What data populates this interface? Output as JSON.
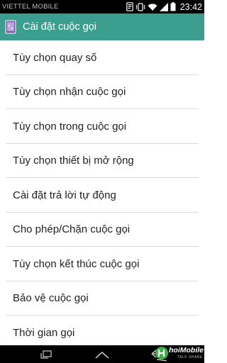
{
  "status_bar": {
    "carrier": "VIETTEL MOBILE",
    "time": "23:42",
    "icons": [
      "notification-icon",
      "vibrate-icon",
      "wifi-icon",
      "signal-icon",
      "battery-icon"
    ]
  },
  "action_bar": {
    "title": "Cài đặt cuộc gọi",
    "background_color": "#3b9e8e"
  },
  "settings_list": {
    "items": [
      {
        "label": "Tùy chọn quay số"
      },
      {
        "label": "Tùy chọn nhận cuộc gọi"
      },
      {
        "label": "Tùy chọn trong cuộc gọi"
      },
      {
        "label": "Tùy chọn thiết bị mở rộng"
      },
      {
        "label": "Cài đặt trả lời tự động"
      },
      {
        "label": "Cho phép/Chặn cuộc gọi"
      },
      {
        "label": "Tùy chọn kết thúc cuộc gọi"
      },
      {
        "label": "Bảo vệ cuộc gọi"
      },
      {
        "label": "Thời gian gọi"
      }
    ]
  },
  "nav_bar": {
    "buttons": [
      "recent-apps-icon",
      "home-icon",
      "back-icon"
    ]
  },
  "watermark": {
    "brand": "hoiMobile",
    "tagline": "TALK SHARE"
  }
}
